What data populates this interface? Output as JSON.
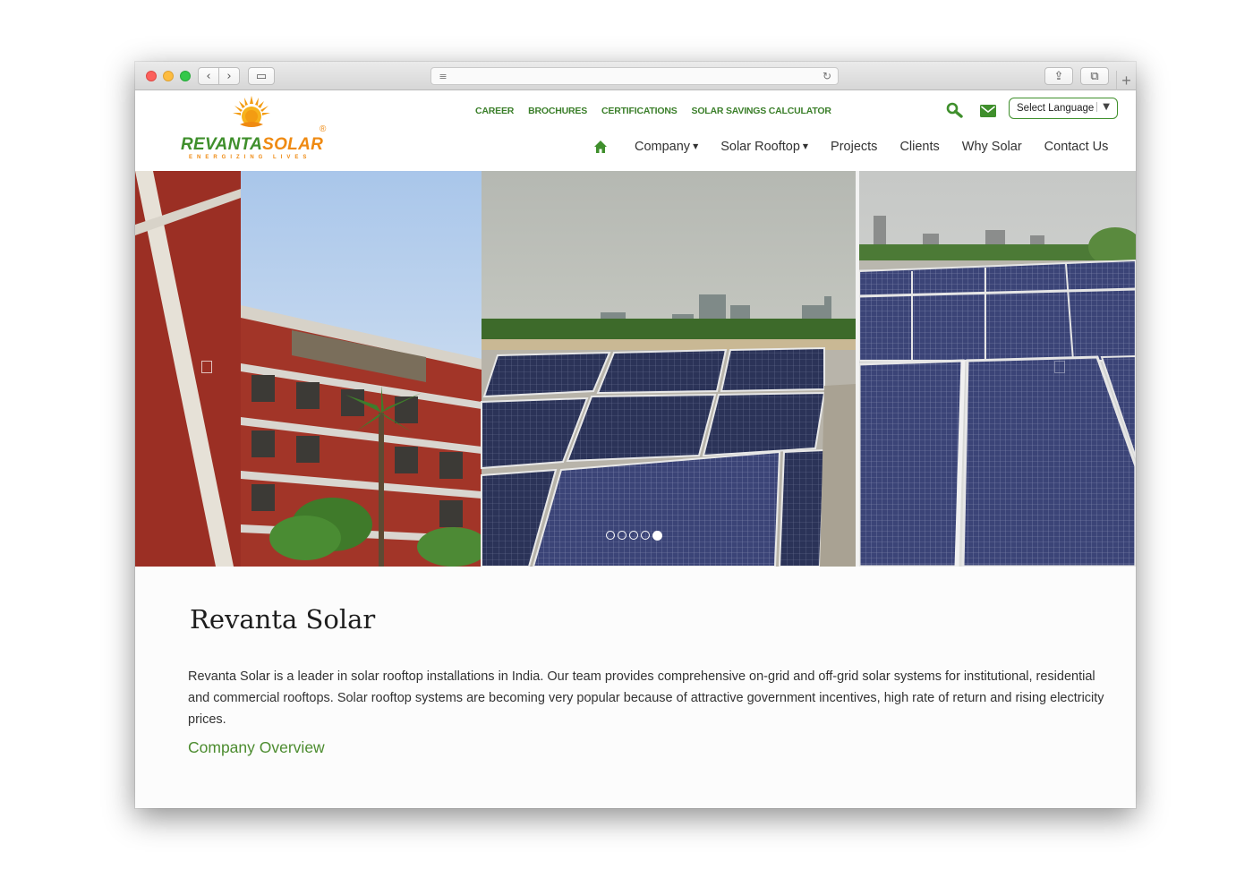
{
  "browser": {
    "back_glyph": "‹",
    "forward_glyph": "›",
    "sidebar_glyph": "▭",
    "reader_glyph": "≡",
    "reload_glyph": "↻",
    "share_glyph": "⇪",
    "tabs_glyph": "⧉",
    "newtab_glyph": "+"
  },
  "logo": {
    "word1": "REVANTA",
    "word2": "SOLAR",
    "registered": "®",
    "tagline": "ENERGIZING LIVES",
    "brand_green": "#3f8f2c",
    "brand_orange": "#ef8a12"
  },
  "toplinks": {
    "career": "CAREER",
    "brochures": "BROCHURES",
    "certifications": "CERTIFICATIONS",
    "calculator": "SOLAR SAVINGS CALCULATOR"
  },
  "header_tools": {
    "search_icon": "search-icon",
    "mail_icon": "mail-icon",
    "language_select": "Select Language",
    "language_arrow": "▼"
  },
  "nav": {
    "home_icon": "home-icon",
    "company": "Company",
    "solar_rooftop": "Solar Rooftop",
    "projects": "Projects",
    "clients": "Clients",
    "why_solar": "Why Solar",
    "contact": "Contact Us",
    "caret": "▼"
  },
  "slider": {
    "slide_count": 5,
    "active_slide": 5
  },
  "content": {
    "title": "Revanta Solar",
    "intro": "Revanta Solar is a leader in solar rooftop installations in India. Our team provides comprehensive on-grid and off-grid solar systems for institutional, residential and commercial rooftops. Solar rooftop systems are becoming very popular because of attractive government incentives, high rate of return and rising electricity prices.",
    "link": "Company Overview"
  }
}
